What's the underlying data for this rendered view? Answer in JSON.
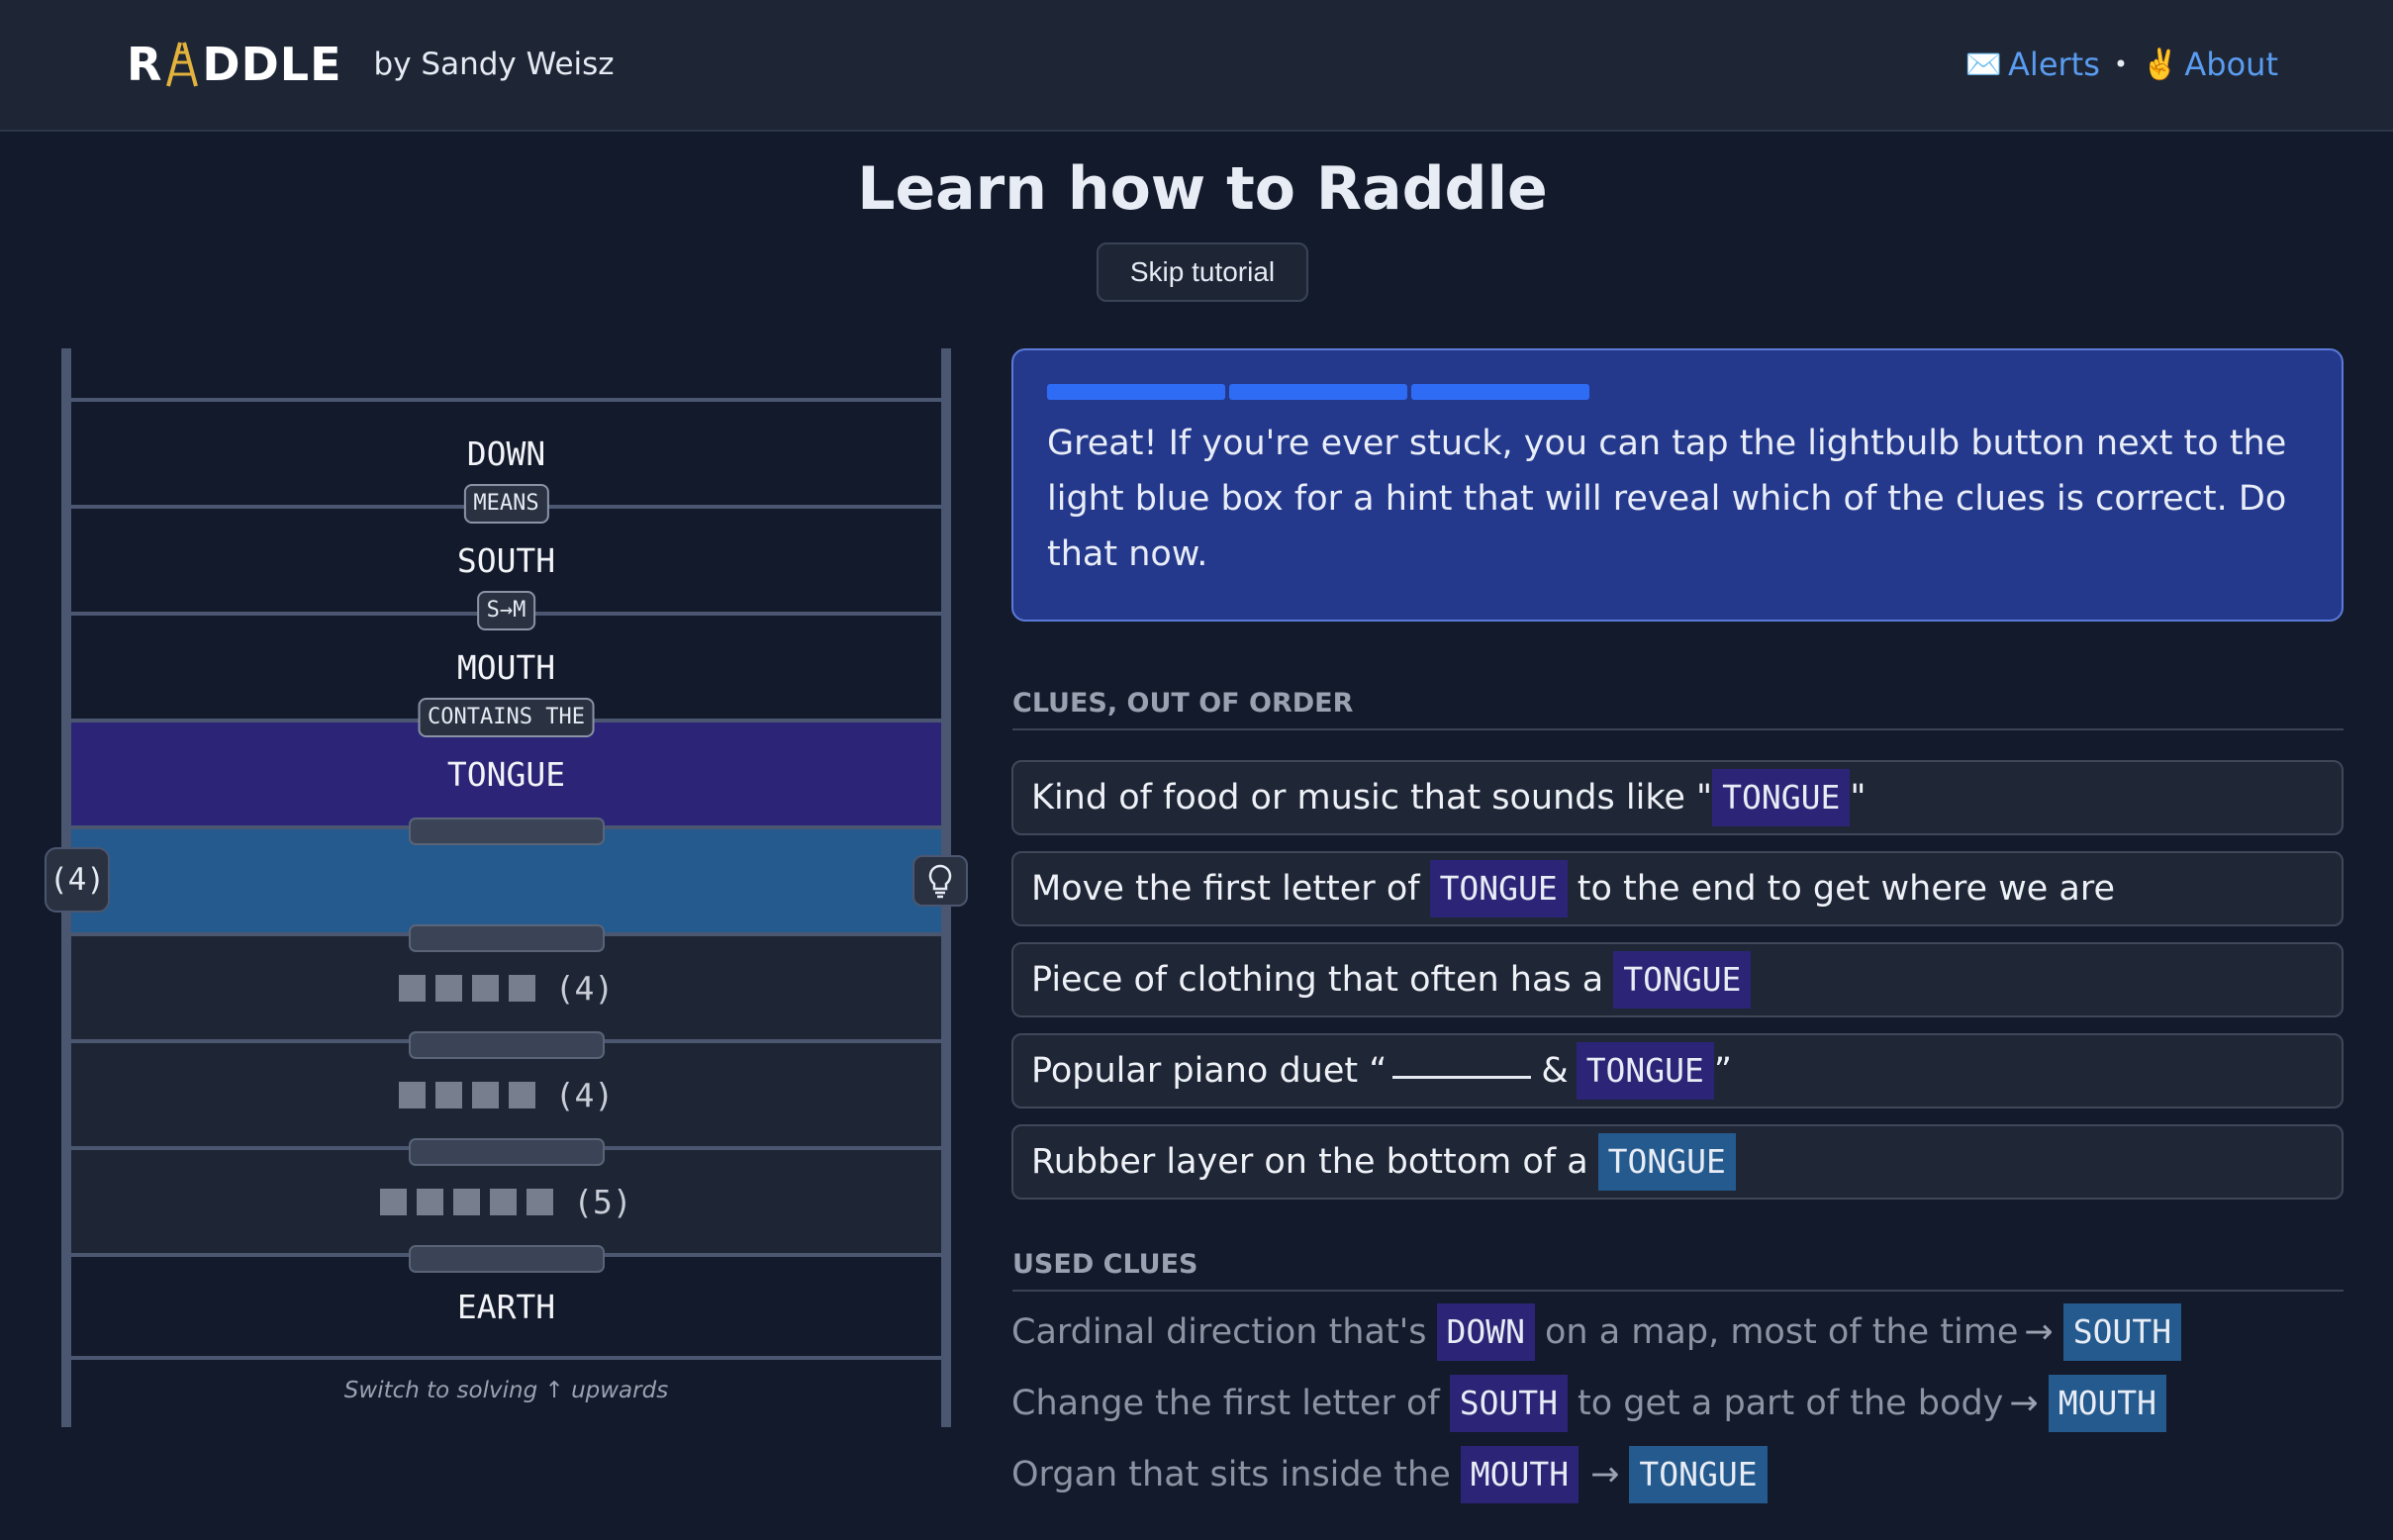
{
  "header": {
    "logo_left": "R",
    "logo_right": "DDLE",
    "byline": "by Sandy Weisz",
    "alerts_icon": "envelope-icon",
    "alerts_label": "Alerts",
    "about_icon": "victory-hand-icon",
    "about_label": "About",
    "separator": "•"
  },
  "page": {
    "title": "Learn how to Raddle",
    "skip_label": "Skip tutorial"
  },
  "ladder": {
    "rungs": [
      {
        "word": "DOWN"
      },
      {
        "word": "SOUTH",
        "transform": "MEANS"
      },
      {
        "word": "MOUTH",
        "transform": "S→M"
      },
      {
        "word": "TONGUE",
        "transform": "CONTAINS THE"
      },
      {
        "word": "",
        "length": "(4)"
      },
      {
        "word": "",
        "length": "(4)"
      },
      {
        "word": "",
        "length": "(4)"
      },
      {
        "word": "",
        "length": "(5)"
      },
      {
        "word": "EARTH"
      }
    ],
    "active_length_badge": "(4)",
    "hint_icon": "lightbulb-icon",
    "switch_label": "Switch to solving ↑ upwards"
  },
  "tutorial": {
    "progress_segments": 3,
    "message": "Great! If you're ever stuck, you can tap the lightbulb button next to the light blue box for a hint that will reveal which of the clues is correct. Do that now."
  },
  "clues": {
    "heading": "CLUES, OUT OF ORDER",
    "items": [
      {
        "before": "Kind of food or music that sounds like \"",
        "word": "TONGUE",
        "after": "\""
      },
      {
        "before": "Move the first letter of",
        "word": "TONGUE",
        "after": "to the end to get where we are"
      },
      {
        "before": "Piece of clothing that often has a",
        "word": "TONGUE",
        "after": ""
      },
      {
        "before": "Popular piano duet “",
        "after_blank": "&",
        "word": "TONGUE",
        "after": "”"
      },
      {
        "before": "Rubber layer on the bottom of a",
        "word": "TONGUE",
        "after": ""
      }
    ]
  },
  "used": {
    "heading": "USED CLUES",
    "items": [
      {
        "before": "Cardinal direction that's",
        "from": "DOWN",
        "middle": "on a map, most of the time",
        "arrow": "→",
        "to": "SOUTH"
      },
      {
        "before": "Change the first letter of",
        "from": "SOUTH",
        "middle": "to get a part of the body",
        "arrow": "→",
        "to": "MOUTH"
      },
      {
        "before": "Organ that sits inside the",
        "from": "MOUTH",
        "middle": "",
        "arrow": "→",
        "to": "TONGUE"
      }
    ]
  }
}
